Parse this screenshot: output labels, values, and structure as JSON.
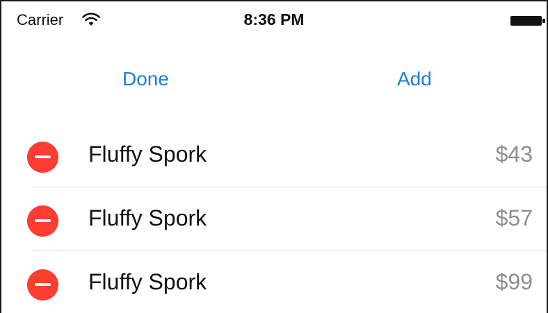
{
  "status_bar": {
    "carrier": "Carrier",
    "time": "8:36 PM",
    "wifi_icon": "wifi-icon",
    "battery_icon": "battery-icon"
  },
  "nav": {
    "left_label": "Done",
    "right_label": "Add"
  },
  "items": [
    {
      "name": "Fluffy Spork",
      "price": "$43"
    },
    {
      "name": "Fluffy Spork",
      "price": "$57"
    },
    {
      "name": "Fluffy Spork",
      "price": "$99"
    }
  ],
  "colors": {
    "tint": "#1a7fd6",
    "delete": "#fc3d30",
    "secondary_text": "#8e8e93"
  }
}
